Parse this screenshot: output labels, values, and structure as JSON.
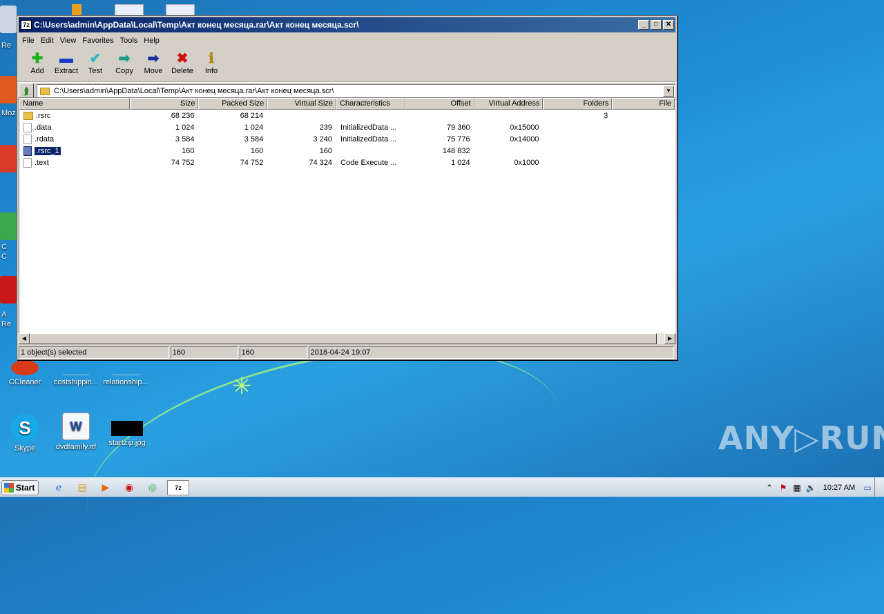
{
  "window": {
    "title": "C:\\Users\\admin\\AppData\\Local\\Temp\\Акт конец месяца.rar\\Акт конец месяца.scr\\",
    "app_icon": "7z",
    "controls": {
      "minimize": "_",
      "maximize": "□",
      "close": "✕"
    }
  },
  "menu": [
    "File",
    "Edit",
    "View",
    "Favorites",
    "Tools",
    "Help"
  ],
  "toolbar": [
    {
      "label": "Add",
      "icon": "plus-icon",
      "glyph": "✚",
      "color": "#1fb01f"
    },
    {
      "label": "Extract",
      "icon": "minus-icon",
      "glyph": "▬",
      "color": "#1a3ac8"
    },
    {
      "label": "Test",
      "icon": "check-icon",
      "glyph": "✔",
      "color": "#2ab8c8"
    },
    {
      "label": "Copy",
      "icon": "copy-arrow-icon",
      "glyph": "➡",
      "color": "#1a9a8a"
    },
    {
      "label": "Move",
      "icon": "move-arrow-icon",
      "glyph": "➡",
      "color": "#1a2aa0"
    },
    {
      "label": "Delete",
      "icon": "delete-x-icon",
      "glyph": "✖",
      "color": "#d01010"
    },
    {
      "label": "Info",
      "icon": "info-icon",
      "glyph": "ℹ",
      "color": "#b08a10"
    }
  ],
  "address": {
    "value": "C:\\Users\\admin\\AppData\\Local\\Temp\\Акт конец месяца.rar\\Акт конец месяца.scr\\"
  },
  "columns": [
    "Name",
    "Size",
    "Packed Size",
    "Virtual Size",
    "Characteristics",
    "Offset",
    "Virtual Address",
    "Folders",
    "File"
  ],
  "rows": [
    {
      "type": "folder",
      "name": ".rsrc",
      "size": "68 236",
      "packed": "68 214",
      "vsize": "",
      "chars": "",
      "offset": "",
      "vaddr": "",
      "folders": "3",
      "selected": false
    },
    {
      "type": "file",
      "name": ".data",
      "size": "1 024",
      "packed": "1 024",
      "vsize": "239",
      "chars": "InitializedData ...",
      "offset": "79 360",
      "vaddr": "0x15000",
      "folders": "",
      "selected": false
    },
    {
      "type": "file",
      "name": ".rdata",
      "size": "3 584",
      "packed": "3 584",
      "vsize": "3 240",
      "chars": "InitializedData ...",
      "offset": "75 776",
      "vaddr": "0x14000",
      "folders": "",
      "selected": false
    },
    {
      "type": "file",
      "name": ".rsrc_1",
      "size": "160",
      "packed": "160",
      "vsize": "160",
      "chars": "",
      "offset": "148 832",
      "vaddr": "",
      "folders": "",
      "selected": true
    },
    {
      "type": "file",
      "name": ".text",
      "size": "74 752",
      "packed": "74 752",
      "vsize": "74 324",
      "chars": "Code Execute ...",
      "offset": "1 024",
      "vaddr": "0x1000",
      "folders": "",
      "selected": false
    }
  ],
  "status": {
    "selection": "1 object(s) selected",
    "size": "160",
    "packed": "160",
    "modified": "2018-04-24 19:07"
  },
  "desktop": {
    "icons": [
      {
        "label": "CCleaner"
      },
      {
        "label": "costshippin..."
      },
      {
        "label": "relationship..."
      },
      {
        "label": "Skype"
      },
      {
        "label": "dvdfamily.rtf"
      },
      {
        "label": "startzip.jpg"
      }
    ],
    "edge_labels": [
      "Re",
      "Moz",
      "C",
      "C",
      "A",
      "Re"
    ]
  },
  "taskbar": {
    "start": "Start",
    "clock": "10:27 AM",
    "active_app": "7z"
  },
  "watermark": "ANY▷RUN"
}
